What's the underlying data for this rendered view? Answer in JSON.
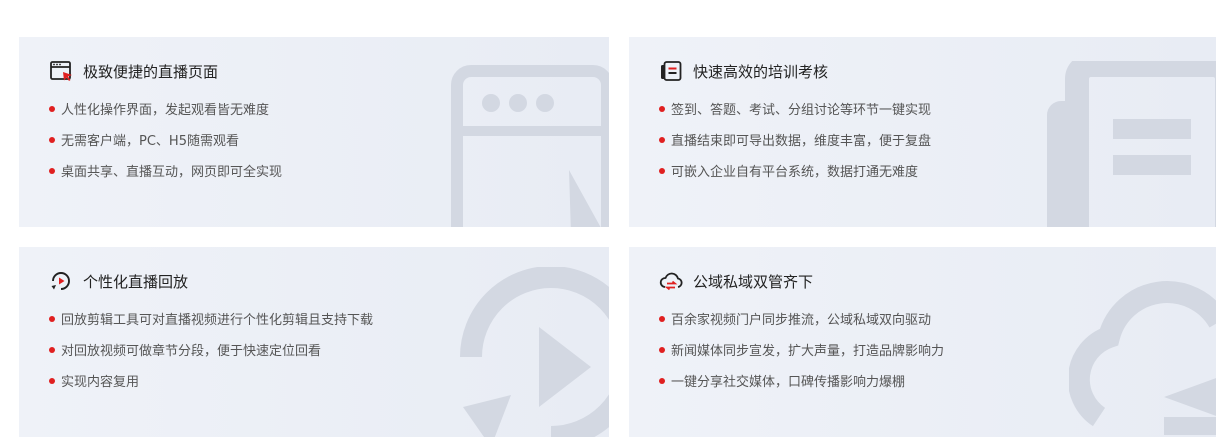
{
  "cards": [
    {
      "title": "极致便捷的直播页面",
      "icon": "browser-cursor-icon",
      "items": [
        "人性化操作界面，发起观看皆无难度",
        "无需客户端，PC、H5随需观看",
        "桌面共享、直播互动，网页即可全实现"
      ]
    },
    {
      "title": "快速高效的培训考核",
      "icon": "document-icon",
      "items": [
        "签到、答题、考试、分组讨论等环节一键实现",
        "直播结束即可导出数据，维度丰富，便于复盘",
        "可嵌入企业自有平台系统，数据打通无难度"
      ]
    },
    {
      "title": "个性化直播回放",
      "icon": "replay-icon",
      "items": [
        "回放剪辑工具可对直播视频进行个性化剪辑且支持下载",
        "对回放视频可做章节分段，便于快速定位回看",
        "实现内容复用"
      ]
    },
    {
      "title": "公域私域双管齐下",
      "icon": "cloud-sync-icon",
      "items": [
        "百余家视频门户同步推流，公域私域双向驱动",
        "新闻媒体同步宣发，扩大声量，打造品牌影响力",
        "一键分享社交媒体，口碑传播影响力爆棚"
      ]
    }
  ],
  "colors": {
    "accent": "#e02020",
    "card_bg": "#eef1f7",
    "title": "#222222",
    "text": "#555555",
    "illustration": "#d5dae3"
  }
}
